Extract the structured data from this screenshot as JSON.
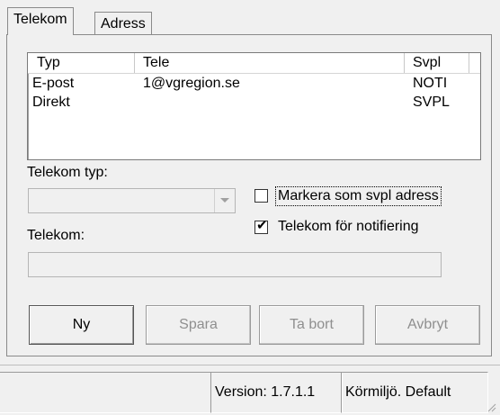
{
  "tabs": [
    {
      "label": "Telekom",
      "selected": true
    },
    {
      "label": "Adress",
      "selected": false
    }
  ],
  "list": {
    "columns": [
      "Typ",
      "Tele",
      "Svpl"
    ],
    "rows": [
      {
        "typ": "E-post",
        "tele": "1@vgregion.se",
        "svpl": "NOTI"
      },
      {
        "typ": "Direkt",
        "tele": "",
        "svpl": "SVPL"
      }
    ]
  },
  "form": {
    "telekom_typ_label": "Telekom typ:",
    "telekom_typ_value": "",
    "telekom_label": "Telekom:",
    "telekom_value": "",
    "markera_label": "Markera som svpl adress",
    "markera_checked": false,
    "notifiering_label": "Telekom för notifiering",
    "notifiering_checked": true
  },
  "buttons": {
    "ny": "Ny",
    "spara": "Spara",
    "ta_bort": "Ta bort",
    "avbryt": "Avbryt"
  },
  "status": {
    "version": "Version: 1.7.1.1",
    "env": "Körmiljö. Default"
  }
}
